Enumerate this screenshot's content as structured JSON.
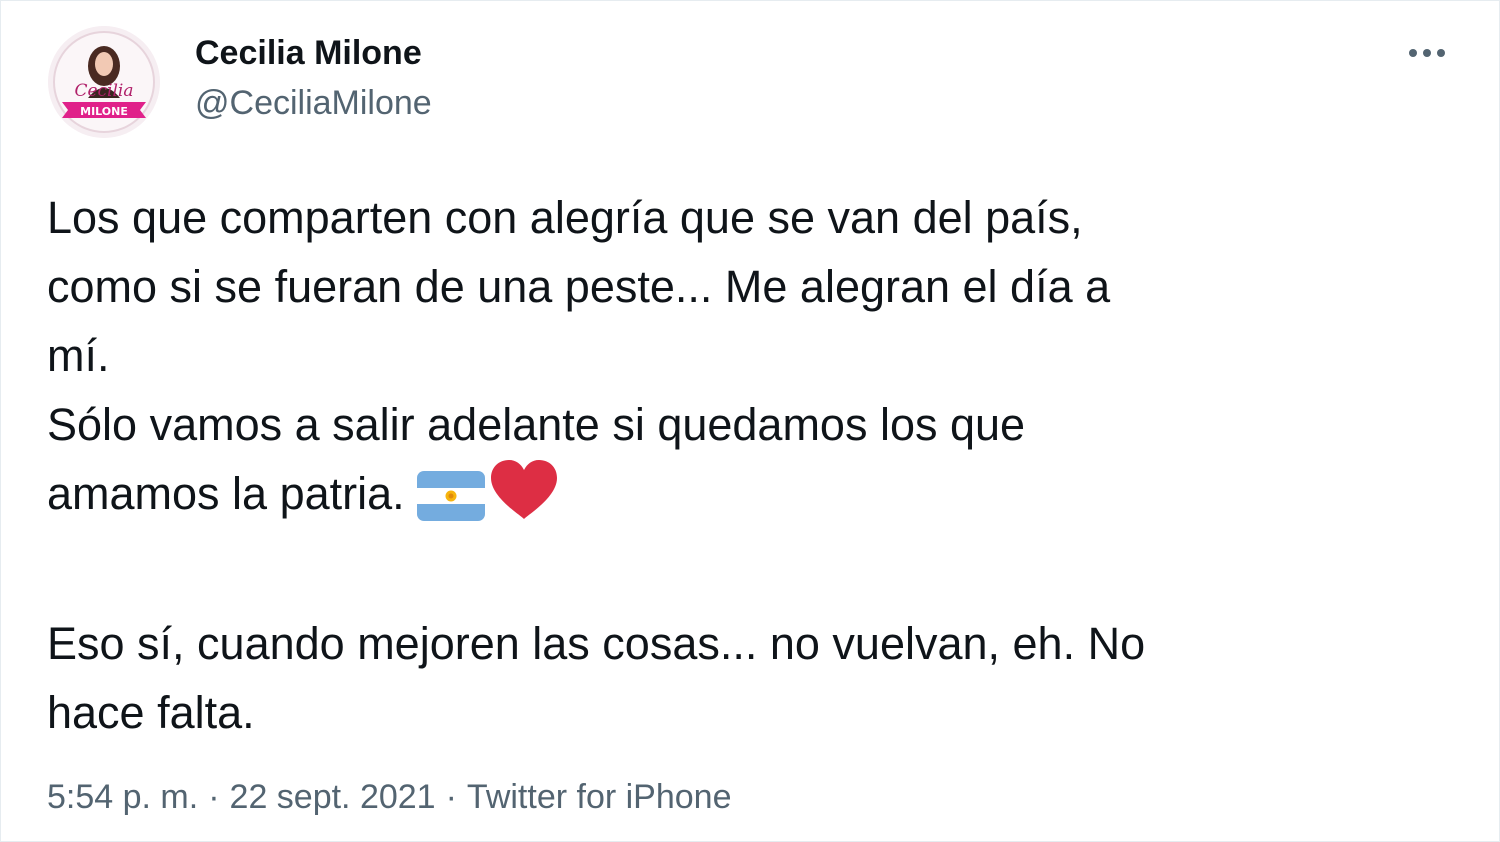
{
  "author": {
    "display_name": "Cecilia Milone",
    "handle": "@CeciliaMilone",
    "avatar_logo_text": "Cecilia MILONE"
  },
  "menu": {
    "more_icon": "more-horizontal-icon"
  },
  "tweet": {
    "text_line1": "Los que comparten con alegría que se van del país,",
    "text_line2": "como si se fueran de una peste... Me alegran el día a",
    "text_line3": "mí.",
    "text_line4": "Sólo vamos a salir adelante si quedamos los que",
    "text_line5": "amamos la patria.",
    "emojis": [
      "argentina-flag-icon",
      "red-heart-icon"
    ],
    "text_line6": "Eso sí, cuando mejoren las cosas... no vuelvan, eh. No",
    "text_line7": "hace falta."
  },
  "meta": {
    "time": "5:54 p. m.",
    "separator": "·",
    "date": "22 sept. 2021",
    "source": "Twitter for iPhone"
  },
  "colors": {
    "text_primary": "#0f1419",
    "text_secondary": "#536471",
    "flag_blue": "#74acdf",
    "sun": "#f6b40e",
    "heart": "#dd2e44",
    "logo_pink": "#e0218a"
  }
}
